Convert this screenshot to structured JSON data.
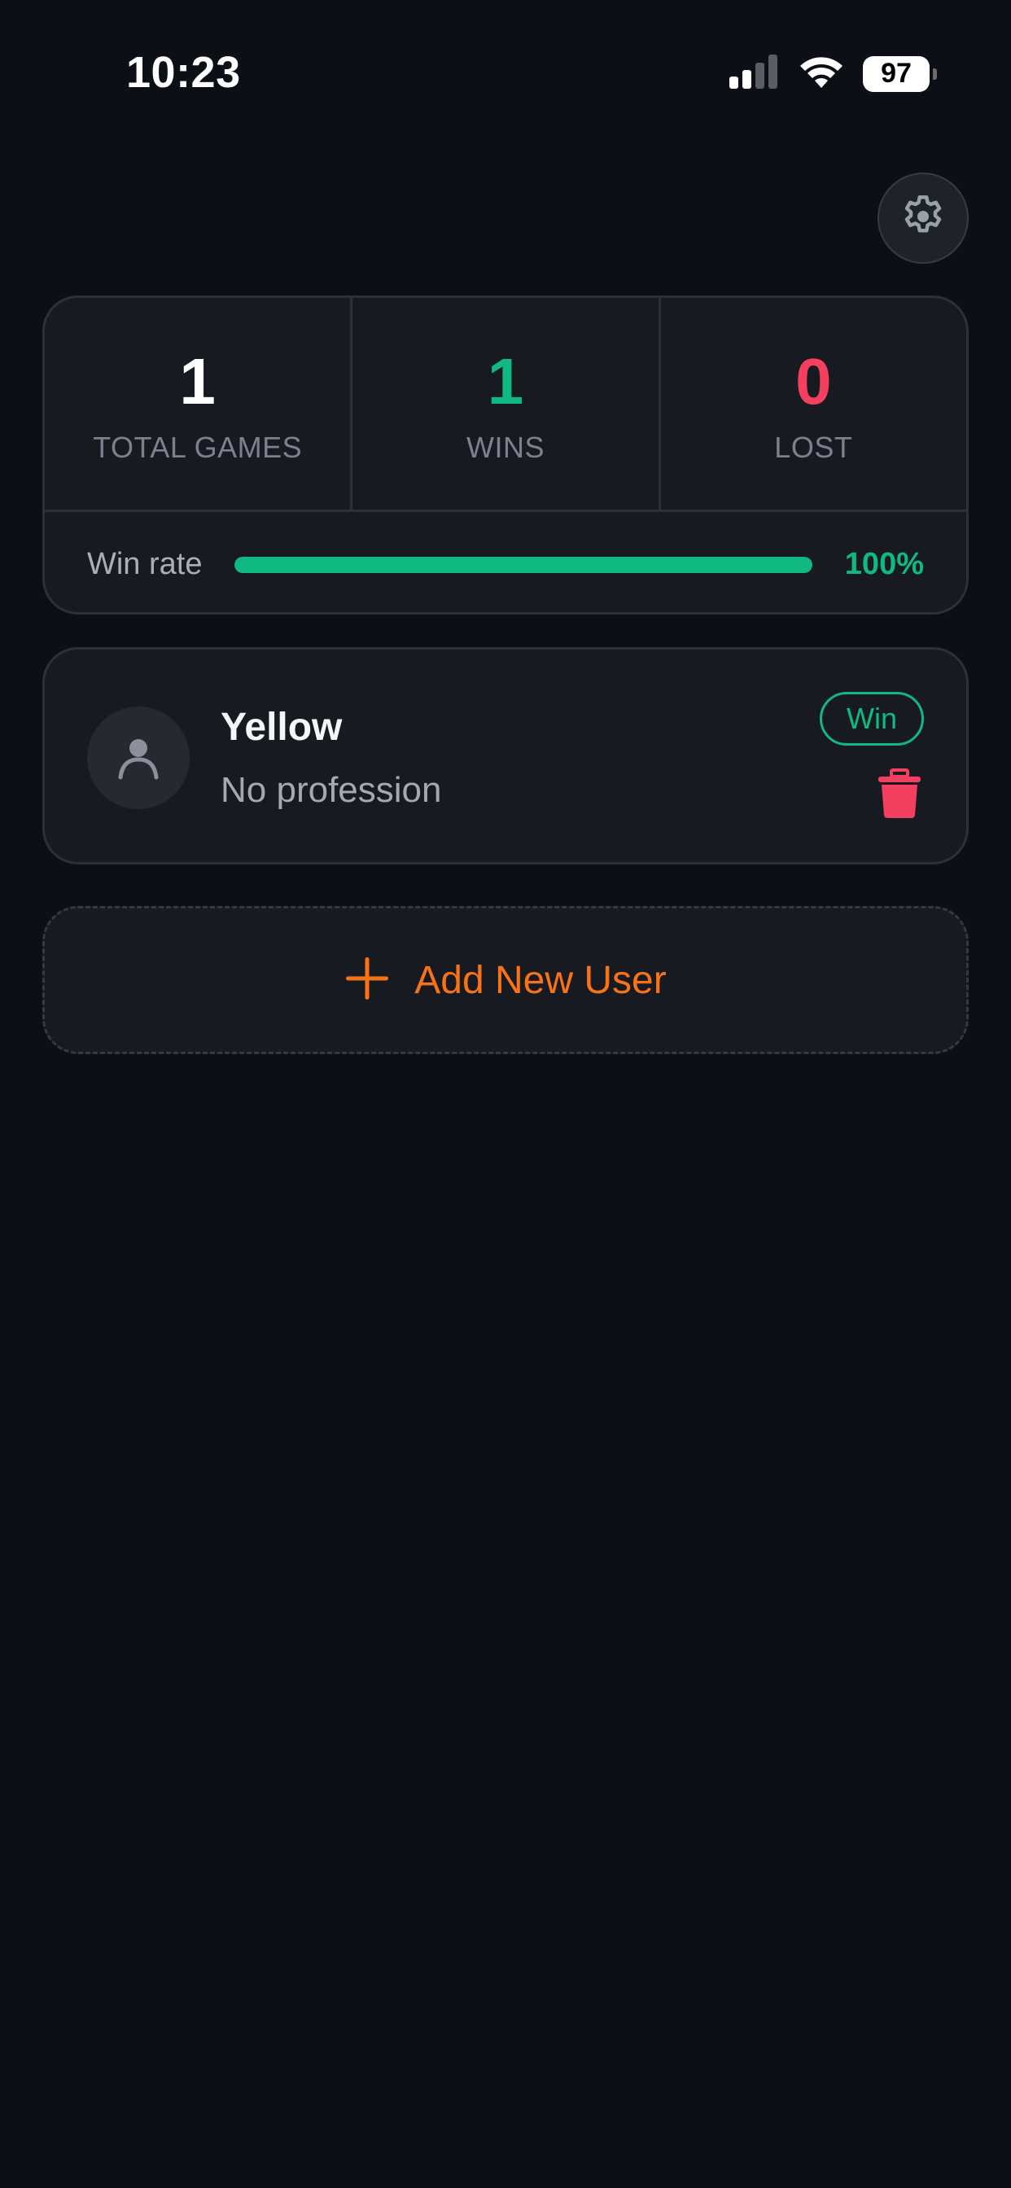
{
  "status_bar": {
    "time": "10:23",
    "battery": "97",
    "icons": [
      "cellular-signal-icon",
      "wifi-icon",
      "battery-icon"
    ]
  },
  "settings": {
    "icon": "gear-icon"
  },
  "stats": {
    "total_games": {
      "value": "1",
      "label": "TOTAL GAMES"
    },
    "wins": {
      "value": "1",
      "label": "WINS"
    },
    "lost": {
      "value": "0",
      "label": "LOST"
    },
    "win_rate": {
      "label": "Win rate",
      "value": "100%",
      "fraction": 1.0
    }
  },
  "users": [
    {
      "name": "Yellow",
      "profession": "No profession",
      "badge": "Win",
      "avatar_icon": "person-icon",
      "delete_icon": "trash-icon"
    }
  ],
  "add_user": {
    "label": "Add New User",
    "icon": "plus-icon"
  },
  "colors": {
    "background": "#0c0f16",
    "card": "#171a21",
    "border": "#2b3039",
    "win_green": "#10b981",
    "loss_red": "#f43f5e",
    "accent_orange": "#f97316",
    "muted_text": "#7b8190"
  }
}
